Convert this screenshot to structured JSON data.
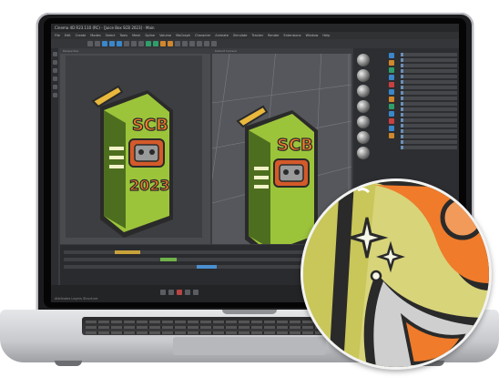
{
  "window": {
    "title": "Cinema 4D R23.110 (RC) - [Juice Box SCB 2023] - Main"
  },
  "menu": {
    "items": [
      "File",
      "Edit",
      "Create",
      "Modes",
      "Select",
      "Tools",
      "Mesh",
      "Spline",
      "Volume",
      "MoGraph",
      "Character",
      "Animate",
      "Simulate",
      "Tracker",
      "Render",
      "Extensions",
      "Window",
      "Help"
    ]
  },
  "viewport_left": {
    "label": "Perspective"
  },
  "viewport_right": {
    "label": "Default Camera"
  },
  "artwork": {
    "text_top": "SCB",
    "text_bottom": "2023",
    "colors": {
      "box": "#9cc43a",
      "box_dark": "#4e6e1f",
      "straw": "#e9b83c",
      "robot": "#d45a2a",
      "lettering": "#ef7b2b",
      "outline": "#2a2a2a"
    }
  },
  "status": {
    "text": "Attributes   Layers   Structure"
  },
  "icons": [
    "play-icon",
    "pause-icon",
    "record-icon",
    "search-icon",
    "gear-icon"
  ]
}
